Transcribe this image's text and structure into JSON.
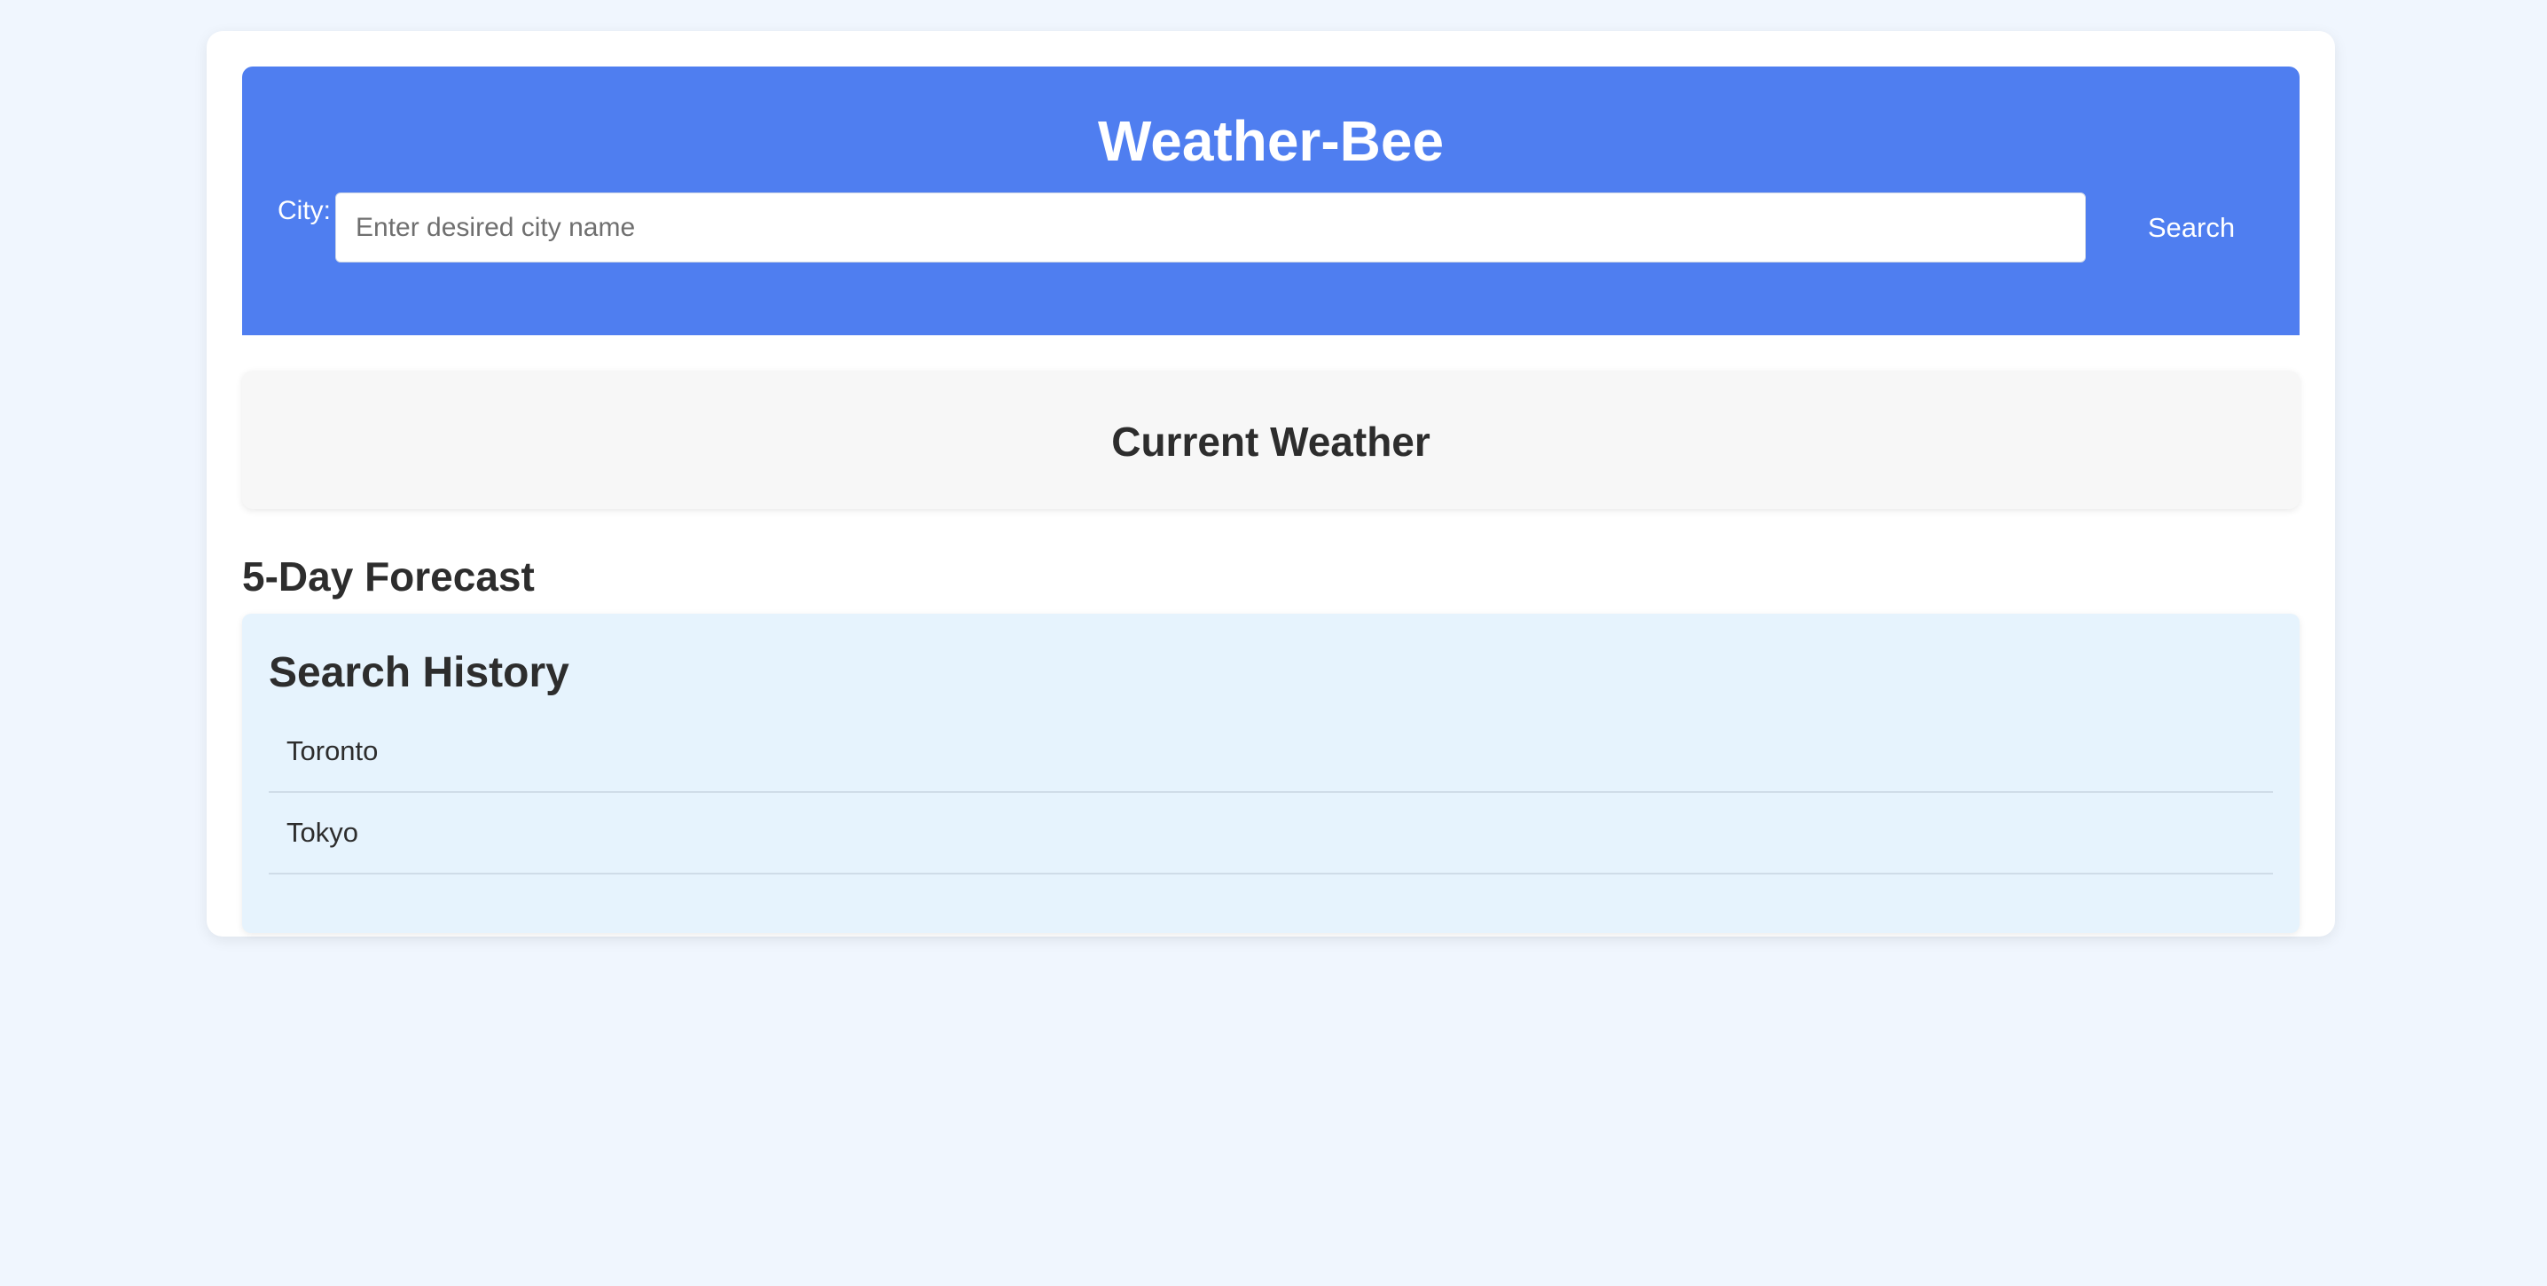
{
  "header": {
    "title": "Weather-Bee",
    "city_label": "City:",
    "search_placeholder": "Enter desired city name",
    "search_value": "",
    "search_button_label": "Search",
    "background_color": "#4f7ef0"
  },
  "current_weather": {
    "heading": "Current Weather"
  },
  "forecast": {
    "heading": "5-Day Forecast"
  },
  "search_history": {
    "heading": "Search History",
    "items": [
      {
        "label": "Toronto"
      },
      {
        "label": "Tokyo"
      }
    ]
  }
}
